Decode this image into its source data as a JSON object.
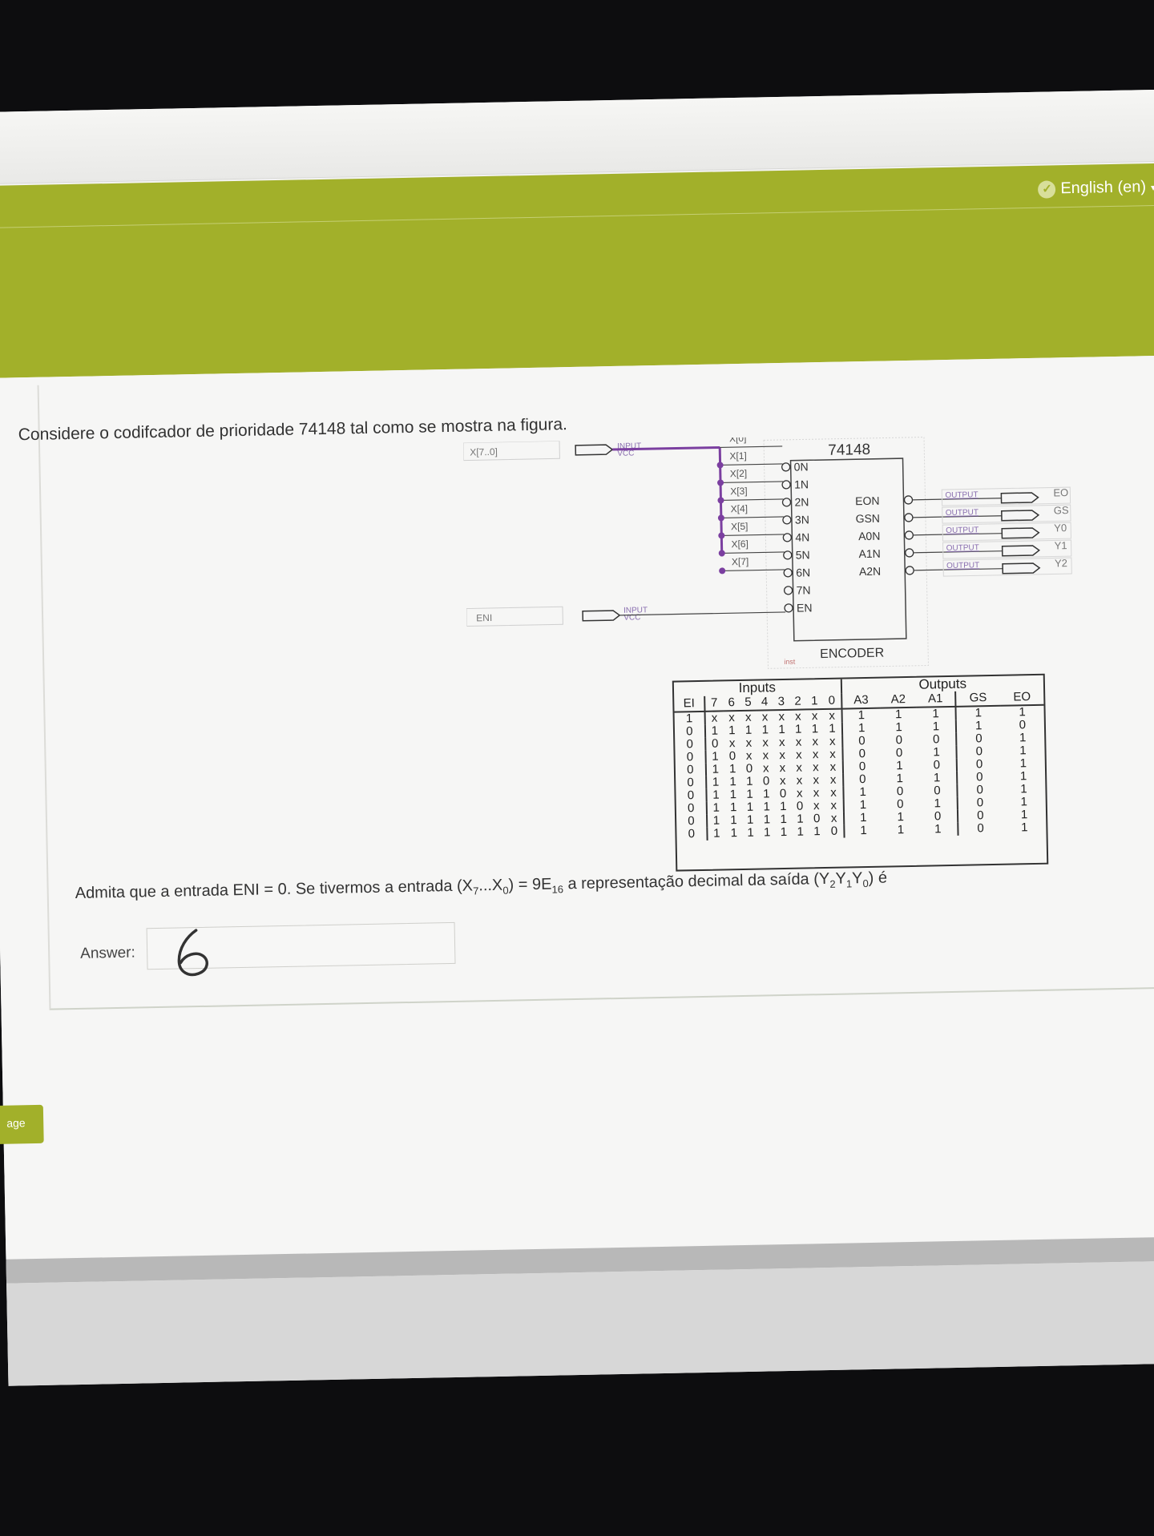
{
  "header": {
    "language": "English (en)"
  },
  "question": {
    "intro": "Considere o codifcador de prioridade 74148 tal como se mostra na figura.",
    "prompt_pre": "Admita que a entrada ENI = 0. Se tivermos a entrada (X",
    "prompt_sub7": "7",
    "prompt_mid": "...X",
    "prompt_sub0": "0",
    "prompt_eq": ") = 9E",
    "prompt_sub16": "16",
    "prompt_post": " a representação decimal da saída (Y",
    "prompt_y2": "2",
    "prompt_y": "Y",
    "prompt_y1": "1",
    "prompt_y0": "0",
    "prompt_end": ") é",
    "answer_label": "Answer:",
    "answer_value": "6"
  },
  "diagram": {
    "chip_title": "74148",
    "chip_name": "ENCODER",
    "bus_input_label": "X[7..0]",
    "eni_label": "ENI",
    "input_tag": "INPUT",
    "vcc_tag": "VCC",
    "output_tag": "OUTPUT",
    "inst_tag": "inst",
    "bus_taps": [
      "X[0]",
      "X[1]",
      "X[2]",
      "X[3]",
      "X[4]",
      "X[5]",
      "X[6]",
      "X[7]"
    ],
    "left_pins": [
      "0N",
      "1N",
      "2N",
      "3N",
      "4N",
      "5N",
      "6N",
      "7N",
      "EN"
    ],
    "right_pins": [
      "EON",
      "GSN",
      "A0N",
      "A1N",
      "A2N"
    ],
    "output_names": [
      "EO",
      "GS",
      "Y0",
      "Y1",
      "Y2"
    ]
  },
  "truth_table": {
    "inputs_title": "Inputs",
    "outputs_title": "Outputs",
    "columns": [
      "EI",
      "7",
      "6",
      "5",
      "4",
      "3",
      "2",
      "1",
      "0",
      "A3",
      "A2",
      "A1",
      "GS",
      "EO"
    ],
    "rows": [
      [
        "1",
        "x",
        "x",
        "x",
        "x",
        "x",
        "x",
        "x",
        "x",
        "1",
        "1",
        "1",
        "1",
        "1"
      ],
      [
        "0",
        "1",
        "1",
        "1",
        "1",
        "1",
        "1",
        "1",
        "1",
        "1",
        "1",
        "1",
        "1",
        "0"
      ],
      [
        "0",
        "0",
        "x",
        "x",
        "x",
        "x",
        "x",
        "x",
        "x",
        "0",
        "0",
        "0",
        "0",
        "1"
      ],
      [
        "0",
        "1",
        "0",
        "x",
        "x",
        "x",
        "x",
        "x",
        "x",
        "0",
        "0",
        "1",
        "0",
        "1"
      ],
      [
        "0",
        "1",
        "1",
        "0",
        "x",
        "x",
        "x",
        "x",
        "x",
        "0",
        "1",
        "0",
        "0",
        "1"
      ],
      [
        "0",
        "1",
        "1",
        "1",
        "0",
        "x",
        "x",
        "x",
        "x",
        "0",
        "1",
        "1",
        "0",
        "1"
      ],
      [
        "0",
        "1",
        "1",
        "1",
        "1",
        "0",
        "x",
        "x",
        "x",
        "1",
        "0",
        "0",
        "0",
        "1"
      ],
      [
        "0",
        "1",
        "1",
        "1",
        "1",
        "1",
        "0",
        "x",
        "x",
        "1",
        "0",
        "1",
        "0",
        "1"
      ],
      [
        "0",
        "1",
        "1",
        "1",
        "1",
        "1",
        "1",
        "0",
        "x",
        "1",
        "1",
        "0",
        "0",
        "1"
      ],
      [
        "0",
        "1",
        "1",
        "1",
        "1",
        "1",
        "1",
        "1",
        "0",
        "1",
        "1",
        "1",
        "0",
        "1"
      ]
    ]
  },
  "nav": {
    "page_button": "age"
  }
}
